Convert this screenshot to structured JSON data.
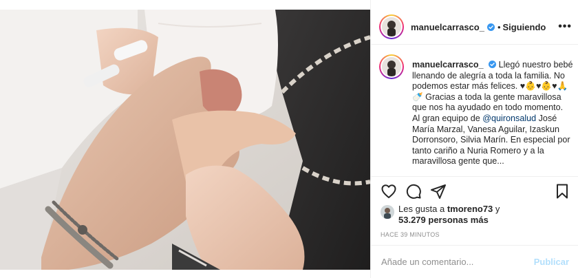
{
  "post": {
    "username": "manuelcarrasco_",
    "separator": "•",
    "follow_status": "Siguiendo",
    "more_label": "•••"
  },
  "caption": {
    "username": "manuelcarrasco_",
    "text_part1": "Llegó nuestro bebé llenando de alegría a toda la familia. No podemos estar más felices. ♥👶♥👶♥🙏🍼 Gracias a toda la gente maravillosa que nos ha ayudado en todo momento.",
    "text_part2": "Al gran equipo de ",
    "mention": "@quironsalud",
    "text_part3": " José María Marzal, Vanesa Aguilar, Izaskun Dorronsoro, Silvia Marín. En especial por tanto cariño a Nuria Romero y a la maravillosa gente que..."
  },
  "likes": {
    "prefix": "Les gusta a ",
    "user": "tmoreno73",
    "connector": " y",
    "count": "53.279 personas más"
  },
  "timestamp": "Hace 39 minutos",
  "comment_box": {
    "placeholder": "Añade un comentario...",
    "publish_label": "Publicar"
  },
  "icons": {
    "like": "heart-icon",
    "comment": "comment-icon",
    "share": "share-icon",
    "save": "bookmark-icon",
    "verified": "verified-badge-icon"
  },
  "colors": {
    "verified": "#3897f0",
    "mention": "#00376b",
    "publish_disabled": "#b2dffc",
    "muted": "#8e8e8e"
  }
}
